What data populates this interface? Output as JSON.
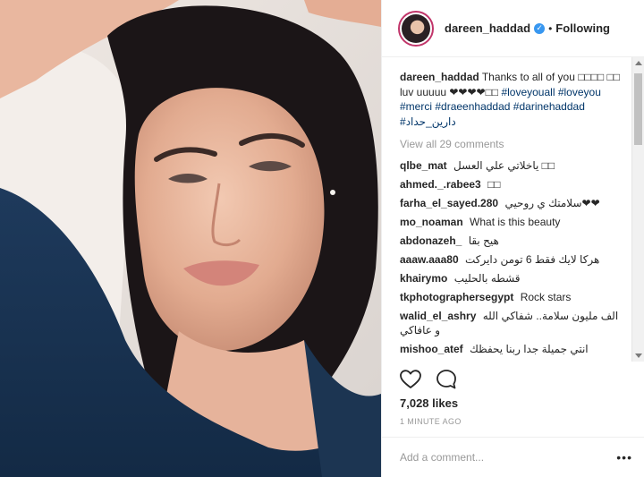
{
  "post": {
    "username": "dareen_haddad",
    "verified_mark": "✓",
    "separator": "•",
    "follow_status": "Following",
    "caption": {
      "username": "dareen_haddad",
      "text": "Thanks to all of you □□□□ □□ luv uuuuu ❤❤❤❤□□",
      "hashtags": [
        "#loveyouall",
        "#loveyou",
        "#merci",
        "#draeenhaddad",
        "#darinehaddad",
        "#دارين_حداد"
      ]
    },
    "view_all_comments": "View all 29 comments",
    "comments": [
      {
        "user": "qlbe_mat",
        "text": "ياخلاتي علي العسل □□"
      },
      {
        "user": "ahmed._.rabee3",
        "text": "□□"
      },
      {
        "user": "farha_el_sayed.280",
        "text": "سلامتك ي روحيي❤❤"
      },
      {
        "user": "mo_noaman",
        "text": "What is this beauty"
      },
      {
        "user": "abdonazeh_",
        "text": "هيح بقا"
      },
      {
        "user": "aaaw.aaa80",
        "text": "هركا لايك فقط 6 تومن دايركت"
      },
      {
        "user": "khairymo",
        "text": "قشطه بالحليب"
      },
      {
        "user": "tkphotographersegypt",
        "text": "Rock stars"
      },
      {
        "user": "walid_el_ashry",
        "text": "الف مليون سلامة.. شفاكي الله و عافاكي"
      },
      {
        "user": "mishoo_atef",
        "text": "انتي جميلة جدا ربنا يحفظك"
      }
    ],
    "likes": "7,028 likes",
    "time": "1 MINUTE AGO",
    "add_comment_placeholder": "Add a comment...",
    "more_options": "•••"
  },
  "icons": {
    "like": "heart-outline-icon",
    "comment": "speech-bubble-icon",
    "more": "ellipsis-icon"
  },
  "colors": {
    "link": "#003569",
    "verified": "#3897f0",
    "muted": "#999999",
    "text": "#262626"
  }
}
